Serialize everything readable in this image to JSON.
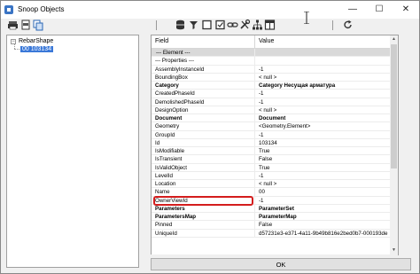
{
  "window": {
    "title": "Snoop Objects",
    "controls": [
      "—",
      "☐",
      "✕"
    ]
  },
  "toolbar": {
    "icons": [
      "print-icon",
      "print-preview-icon",
      "copy-icon",
      "database-icon",
      "filter-icon",
      "square-icon",
      "checkbox-icon",
      "link-icon",
      "tools-icon",
      "hierarchy-icon",
      "table-icon",
      "refresh-icon"
    ]
  },
  "tree": {
    "root_label": "RebarShape",
    "child_label": "00   103134",
    "expander": "−"
  },
  "grid": {
    "col_field": "Field",
    "col_value": "Value",
    "rows": [
      {
        "field": "--- Element ---",
        "value": "",
        "type": "section"
      },
      {
        "field": "--- Properties ---",
        "value": "",
        "type": "plain"
      },
      {
        "field": "AssemblyInstanceId",
        "value": "-1",
        "type": "plain"
      },
      {
        "field": "BoundingBox",
        "value": "< null >",
        "type": "plain"
      },
      {
        "field": "Category",
        "value": "Category  Несущая арматура",
        "type": "bold"
      },
      {
        "field": "CreatedPhaseId",
        "value": "-1",
        "type": "plain"
      },
      {
        "field": "DemolishedPhaseId",
        "value": "-1",
        "type": "plain"
      },
      {
        "field": "DesignOption",
        "value": "< null >",
        "type": "plain"
      },
      {
        "field": "Document",
        "value": "Document",
        "type": "bold"
      },
      {
        "field": "Geometry",
        "value": "<Geometry.Element>",
        "type": "plain"
      },
      {
        "field": "GroupId",
        "value": "-1",
        "type": "plain"
      },
      {
        "field": "Id",
        "value": "103134",
        "type": "plain"
      },
      {
        "field": "IsModifiable",
        "value": "True",
        "type": "plain"
      },
      {
        "field": "IsTransient",
        "value": "False",
        "type": "plain"
      },
      {
        "field": "IsValidObject",
        "value": "True",
        "type": "plain"
      },
      {
        "field": "LevelId",
        "value": "-1",
        "type": "plain"
      },
      {
        "field": "Location",
        "value": "< null >",
        "type": "plain"
      },
      {
        "field": "Name",
        "value": "00",
        "type": "plain"
      },
      {
        "field": "OwnerViewId",
        "value": "-1",
        "type": "plain"
      },
      {
        "field": "Parameters",
        "value": "ParameterSet",
        "type": "bold"
      },
      {
        "field": "ParametersMap",
        "value": "ParameterMap",
        "type": "bold"
      },
      {
        "field": "Pinned",
        "value": "False",
        "type": "plain"
      },
      {
        "field": "UniqueId",
        "value": "d57231e3-e371-4a11-9b49b816e2bed0b7-000193de",
        "type": "plain"
      }
    ]
  },
  "footer": {
    "ok_label": "OK"
  }
}
